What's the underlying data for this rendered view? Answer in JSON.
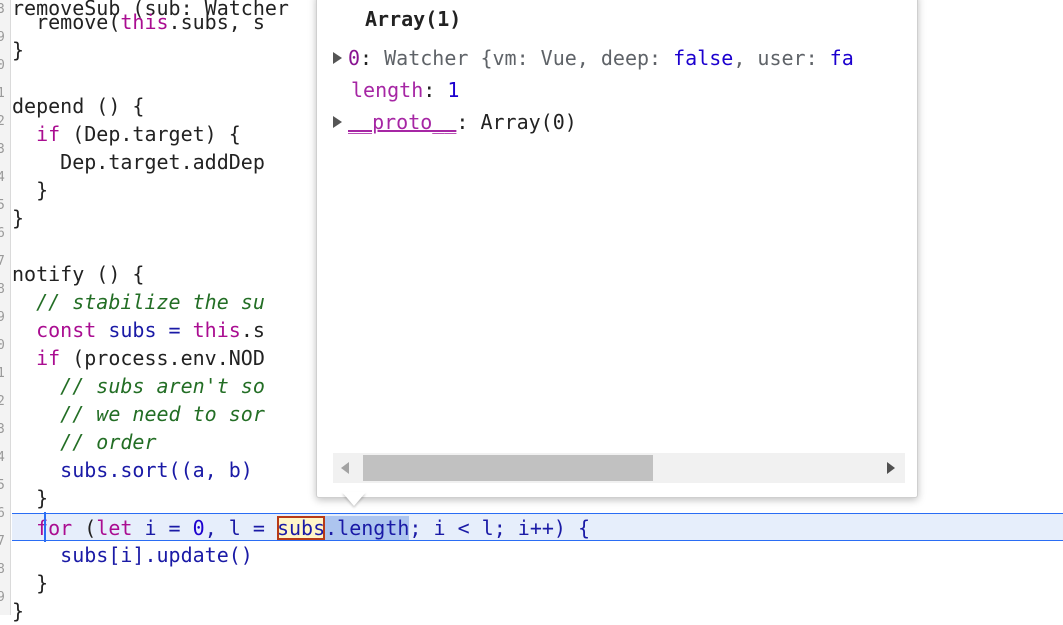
{
  "gutter_numbers": [
    "3",
    "9",
    "0",
    "1",
    "2",
    "3",
    "4",
    "5",
    "6",
    "7",
    "8",
    "9",
    "0",
    "1",
    "2",
    "3",
    "4",
    "5",
    "6",
    "7",
    "8",
    "9"
  ],
  "code": {
    "l0": "removeSub (sub: Watcher",
    "l1a": "  remove(",
    "l1b": "this",
    "l1c": ".subs, s",
    "l2": "}",
    "l4": "depend () {",
    "l5a": "  ",
    "l5b": "if",
    "l5c": " (Dep.target) {",
    "l6": "    Dep.target.addDep",
    "l7": "  }",
    "l8": "}",
    "l10": "notify () {",
    "l11": "  // stabilize the su",
    "l12a": "  ",
    "l12b": "const",
    "l12c": " subs = ",
    "l12d": "this",
    "l12e": ".s",
    "l13a": "  ",
    "l13b": "if",
    "l13c": " (process.env.NOD",
    "l14": "    // subs aren't so",
    "l15": "    // we need to sor",
    "l16": "    // order",
    "l17": "    subs.sort((a, b)",
    "l18": "  }",
    "l19a": "  ",
    "l19b": "for",
    "l19c": " (",
    "l19d": "let",
    "l19e": " i = ",
    "l19f": "0",
    "l19g": ", l = ",
    "l19h": "subs",
    "l19i": ".length",
    "l19j": "; i < l; i++) {",
    "l20": "    subs[i].update()",
    "l21": "  }",
    "l22": "}"
  },
  "popover": {
    "title": "Array(1)",
    "row0_key": "0",
    "row0_sep": ": ",
    "row0_text": "Watcher {vm: Vue, deep: ",
    "row0_false": "false",
    "row0_text2": ", user: ",
    "row0_tail": "fa",
    "row1_key": "length",
    "row1_sep": ": ",
    "row1_val": "1",
    "row2_key": "__proto__",
    "row2_sep": ": ",
    "row2_val": "Array(0)"
  },
  "colors": {
    "keyword": "#aa0d91",
    "comment": "#236e25",
    "number": "#1c00cf",
    "exec_line_bg": "#e6eefb",
    "exec_line_border": "#2a6df4"
  }
}
